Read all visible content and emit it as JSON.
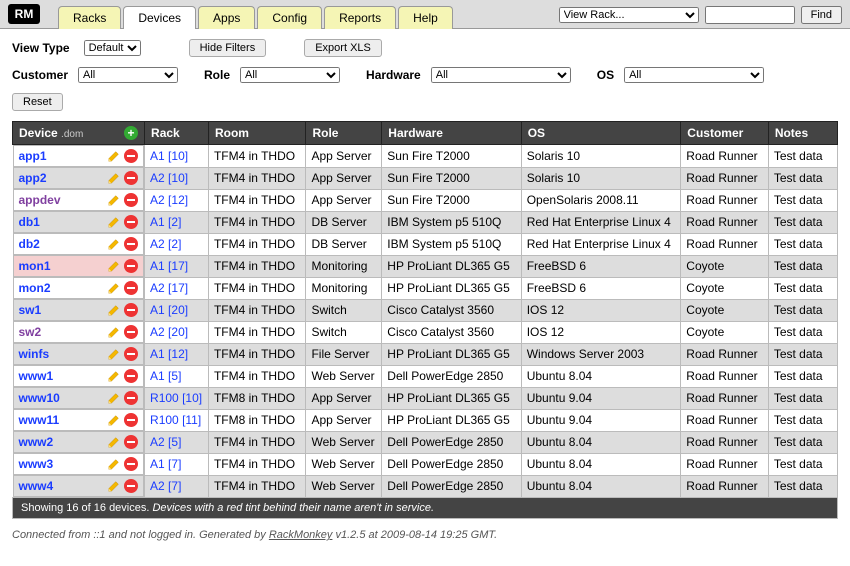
{
  "logo": "RM",
  "tabs": [
    "Racks",
    "Devices",
    "Apps",
    "Config",
    "Reports",
    "Help"
  ],
  "active_tab": 1,
  "nav": {
    "rack_select": "View Rack...",
    "search_value": "",
    "find_label": "Find"
  },
  "view_type": {
    "label": "View Type",
    "value": "Default"
  },
  "buttons": {
    "hide_filters": "Hide Filters",
    "export_xls": "Export XLS",
    "reset": "Reset"
  },
  "filters": {
    "customer": {
      "label": "Customer",
      "value": "All"
    },
    "role": {
      "label": "Role",
      "value": "All"
    },
    "hardware": {
      "label": "Hardware",
      "value": "All"
    },
    "os": {
      "label": "OS",
      "value": "All"
    }
  },
  "columns": {
    "device": "Device",
    "device_sub": ".dom",
    "rack": "Rack",
    "room": "Room",
    "role": "Role",
    "hardware": "Hardware",
    "os": "OS",
    "customer": "Customer",
    "notes": "Notes"
  },
  "rows": [
    {
      "device": "app1",
      "rack": "A1 [10]",
      "room": "TFM4 in THDO",
      "role": "App Server",
      "hw": "Sun Fire T2000",
      "os": "Solaris 10",
      "cust": "Road Runner",
      "notes": "Test data",
      "out": false,
      "visited": false
    },
    {
      "device": "app2",
      "rack": "A2 [10]",
      "room": "TFM4 in THDO",
      "role": "App Server",
      "hw": "Sun Fire T2000",
      "os": "Solaris 10",
      "cust": "Road Runner",
      "notes": "Test data",
      "out": false,
      "visited": false
    },
    {
      "device": "appdev",
      "rack": "A2 [12]",
      "room": "TFM4 in THDO",
      "role": "App Server",
      "hw": "Sun Fire T2000",
      "os": "OpenSolaris 2008.11",
      "cust": "Road Runner",
      "notes": "Test data",
      "out": false,
      "visited": true
    },
    {
      "device": "db1",
      "rack": "A1 [2]",
      "room": "TFM4 in THDO",
      "role": "DB Server",
      "hw": "IBM System p5 510Q",
      "os": "Red Hat Enterprise Linux 4",
      "cust": "Road Runner",
      "notes": "Test data",
      "out": false,
      "visited": false
    },
    {
      "device": "db2",
      "rack": "A2 [2]",
      "room": "TFM4 in THDO",
      "role": "DB Server",
      "hw": "IBM System p5 510Q",
      "os": "Red Hat Enterprise Linux 4",
      "cust": "Road Runner",
      "notes": "Test data",
      "out": false,
      "visited": false
    },
    {
      "device": "mon1",
      "rack": "A1 [17]",
      "room": "TFM4 in THDO",
      "role": "Monitoring",
      "hw": "HP ProLiant DL365 G5",
      "os": "FreeBSD 6",
      "cust": "Coyote",
      "notes": "Test data",
      "out": true,
      "visited": false
    },
    {
      "device": "mon2",
      "rack": "A2 [17]",
      "room": "TFM4 in THDO",
      "role": "Monitoring",
      "hw": "HP ProLiant DL365 G5",
      "os": "FreeBSD 6",
      "cust": "Coyote",
      "notes": "Test data",
      "out": false,
      "visited": false
    },
    {
      "device": "sw1",
      "rack": "A1 [20]",
      "room": "TFM4 in THDO",
      "role": "Switch",
      "hw": "Cisco Catalyst 3560",
      "os": "IOS 12",
      "cust": "Coyote",
      "notes": "Test data",
      "out": false,
      "visited": false
    },
    {
      "device": "sw2",
      "rack": "A2 [20]",
      "room": "TFM4 in THDO",
      "role": "Switch",
      "hw": "Cisco Catalyst 3560",
      "os": "IOS 12",
      "cust": "Coyote",
      "notes": "Test data",
      "out": false,
      "visited": true
    },
    {
      "device": "winfs",
      "rack": "A1 [12]",
      "room": "TFM4 in THDO",
      "role": "File Server",
      "hw": "HP ProLiant DL365 G5",
      "os": "Windows Server 2003",
      "cust": "Road Runner",
      "notes": "Test data",
      "out": false,
      "visited": false
    },
    {
      "device": "www1",
      "rack": "A1 [5]",
      "room": "TFM4 in THDO",
      "role": "Web Server",
      "hw": "Dell PowerEdge 2850",
      "os": "Ubuntu 8.04",
      "cust": "Road Runner",
      "notes": "Test data",
      "out": false,
      "visited": false
    },
    {
      "device": "www10",
      "rack": "R100 [10]",
      "room": "TFM8 in THDO",
      "role": "App Server",
      "hw": "HP ProLiant DL365 G5",
      "os": "Ubuntu 9.04",
      "cust": "Road Runner",
      "notes": "Test data",
      "out": false,
      "visited": false
    },
    {
      "device": "www11",
      "rack": "R100 [11]",
      "room": "TFM8 in THDO",
      "role": "App Server",
      "hw": "HP ProLiant DL365 G5",
      "os": "Ubuntu 9.04",
      "cust": "Road Runner",
      "notes": "Test data",
      "out": false,
      "visited": false
    },
    {
      "device": "www2",
      "rack": "A2 [5]",
      "room": "TFM4 in THDO",
      "role": "Web Server",
      "hw": "Dell PowerEdge 2850",
      "os": "Ubuntu 8.04",
      "cust": "Road Runner",
      "notes": "Test data",
      "out": false,
      "visited": false
    },
    {
      "device": "www3",
      "rack": "A1 [7]",
      "room": "TFM4 in THDO",
      "role": "Web Server",
      "hw": "Dell PowerEdge 2850",
      "os": "Ubuntu 8.04",
      "cust": "Road Runner",
      "notes": "Test data",
      "out": false,
      "visited": false
    },
    {
      "device": "www4",
      "rack": "A2 [7]",
      "room": "TFM4 in THDO",
      "role": "Web Server",
      "hw": "Dell PowerEdge 2850",
      "os": "Ubuntu 8.04",
      "cust": "Road Runner",
      "notes": "Test data",
      "out": false,
      "visited": false
    }
  ],
  "footer_table": {
    "count": "Showing 16 of 16 devices.",
    "hint": "Devices with a red tint behind their name aren't in service."
  },
  "footer_page": {
    "text1": "Connected from ::1 and not logged in. Generated by ",
    "link": "RackMonkey",
    "text2": " v1.2.5  at 2009-08-14 19:25 GMT."
  }
}
